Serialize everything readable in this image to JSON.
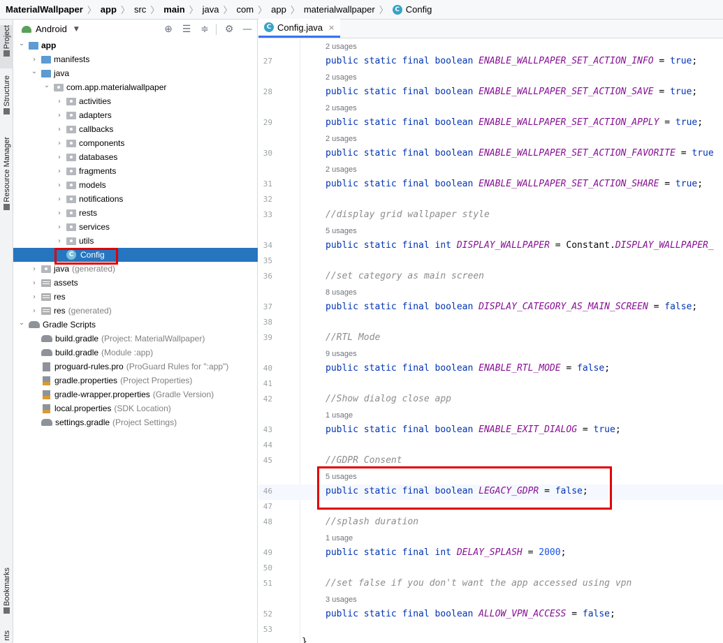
{
  "breadcrumb": {
    "items": [
      "MaterialWallpaper",
      "app",
      "src",
      "main",
      "java",
      "com",
      "app",
      "materialwallpaper"
    ],
    "bold_items": [
      "MaterialWallpaper",
      "app",
      "main"
    ],
    "current": "Config",
    "class_badge": "C"
  },
  "tool_strip": {
    "project": "Project",
    "structure": "Structure",
    "resource_manager": "Resource Manager",
    "bookmarks": "Bookmarks",
    "truncated_bottom": "nts"
  },
  "project_panel": {
    "view_label": "Android",
    "header_icons": [
      "locate-icon",
      "expand-all-icon",
      "collapse-all-icon",
      "gear-icon",
      "hide-icon"
    ],
    "tree": [
      {
        "label": "app",
        "hint": "",
        "indent": 0,
        "chev": "expanded",
        "icon": "module",
        "bold": true
      },
      {
        "label": "manifests",
        "hint": "",
        "indent": 1,
        "chev": "collapsed",
        "icon": "folder-blue"
      },
      {
        "label": "java",
        "hint": "",
        "indent": 1,
        "chev": "expanded",
        "icon": "folder-blue"
      },
      {
        "label": "com.app.materialwallpaper",
        "hint": "",
        "indent": 2,
        "chev": "expanded",
        "icon": "package"
      },
      {
        "label": "activities",
        "hint": "",
        "indent": 3,
        "chev": "collapsed",
        "icon": "package"
      },
      {
        "label": "adapters",
        "hint": "",
        "indent": 3,
        "chev": "collapsed",
        "icon": "package"
      },
      {
        "label": "callbacks",
        "hint": "",
        "indent": 3,
        "chev": "collapsed",
        "icon": "package"
      },
      {
        "label": "components",
        "hint": "",
        "indent": 3,
        "chev": "collapsed",
        "icon": "package"
      },
      {
        "label": "databases",
        "hint": "",
        "indent": 3,
        "chev": "collapsed",
        "icon": "package"
      },
      {
        "label": "fragments",
        "hint": "",
        "indent": 3,
        "chev": "collapsed",
        "icon": "package"
      },
      {
        "label": "models",
        "hint": "",
        "indent": 3,
        "chev": "collapsed",
        "icon": "package"
      },
      {
        "label": "notifications",
        "hint": "",
        "indent": 3,
        "chev": "collapsed",
        "icon": "package"
      },
      {
        "label": "rests",
        "hint": "",
        "indent": 3,
        "chev": "collapsed",
        "icon": "package"
      },
      {
        "label": "services",
        "hint": "",
        "indent": 3,
        "chev": "collapsed",
        "icon": "package"
      },
      {
        "label": "utils",
        "hint": "",
        "indent": 3,
        "chev": "collapsed",
        "icon": "package"
      },
      {
        "label": "Config",
        "hint": "",
        "indent": 3,
        "chev": "none",
        "icon": "class",
        "selected": true
      },
      {
        "label": "java",
        "hint": "(generated)",
        "indent": 1,
        "chev": "collapsed",
        "icon": "folder-gen"
      },
      {
        "label": "assets",
        "hint": "",
        "indent": 1,
        "chev": "collapsed",
        "icon": "folder-res"
      },
      {
        "label": "res",
        "hint": "",
        "indent": 1,
        "chev": "collapsed",
        "icon": "folder-res"
      },
      {
        "label": "res",
        "hint": "(generated)",
        "indent": 1,
        "chev": "collapsed",
        "icon": "folder-res"
      },
      {
        "label": "Gradle Scripts",
        "hint": "",
        "indent": 0,
        "chev": "expanded",
        "icon": "gradle"
      },
      {
        "label": "build.gradle",
        "hint": "(Project: MaterialWallpaper)",
        "indent": 1,
        "chev": "none",
        "icon": "gradle"
      },
      {
        "label": "build.gradle",
        "hint": "(Module :app)",
        "indent": 1,
        "chev": "none",
        "icon": "gradle"
      },
      {
        "label": "proguard-rules.pro",
        "hint": "(ProGuard Rules for \":app\")",
        "indent": 1,
        "chev": "none",
        "icon": "file"
      },
      {
        "label": "gradle.properties",
        "hint": "(Project Properties)",
        "indent": 1,
        "chev": "none",
        "icon": "props"
      },
      {
        "label": "gradle-wrapper.properties",
        "hint": "(Gradle Version)",
        "indent": 1,
        "chev": "none",
        "icon": "props"
      },
      {
        "label": "local.properties",
        "hint": "(SDK Location)",
        "indent": 1,
        "chev": "none",
        "icon": "props"
      },
      {
        "label": "settings.gradle",
        "hint": "(Project Settings)",
        "indent": 1,
        "chev": "none",
        "icon": "gradle"
      }
    ]
  },
  "editor": {
    "tab": {
      "label": "Config.java",
      "badge": "C",
      "close": "×"
    },
    "closing_brace": "}",
    "rows": [
      {
        "type": "usage",
        "text": "2 usages"
      },
      {
        "type": "code",
        "line": 27,
        "tokens": [
          [
            "kw",
            "public static final boolean "
          ],
          [
            "const",
            "ENABLE_WALLPAPER_SET_ACTION_INFO"
          ],
          [
            "plain",
            " = "
          ],
          [
            "kw",
            "true"
          ],
          [
            "plain",
            ";"
          ]
        ]
      },
      {
        "type": "usage",
        "text": "2 usages"
      },
      {
        "type": "code",
        "line": 28,
        "tokens": [
          [
            "kw",
            "public static final boolean "
          ],
          [
            "const",
            "ENABLE_WALLPAPER_SET_ACTION_SAVE"
          ],
          [
            "plain",
            " = "
          ],
          [
            "kw",
            "true"
          ],
          [
            "plain",
            ";"
          ]
        ]
      },
      {
        "type": "usage",
        "text": "2 usages"
      },
      {
        "type": "code",
        "line": 29,
        "tokens": [
          [
            "kw",
            "public static final boolean "
          ],
          [
            "const",
            "ENABLE_WALLPAPER_SET_ACTION_APPLY"
          ],
          [
            "plain",
            " = "
          ],
          [
            "kw",
            "true"
          ],
          [
            "plain",
            ";"
          ]
        ]
      },
      {
        "type": "usage",
        "text": "2 usages"
      },
      {
        "type": "code",
        "line": 30,
        "tokens": [
          [
            "kw",
            "public static final boolean "
          ],
          [
            "const",
            "ENABLE_WALLPAPER_SET_ACTION_FAVORITE"
          ],
          [
            "plain",
            " = "
          ],
          [
            "kw",
            "true"
          ]
        ]
      },
      {
        "type": "usage",
        "text": "2 usages"
      },
      {
        "type": "code",
        "line": 31,
        "tokens": [
          [
            "kw",
            "public static final boolean "
          ],
          [
            "const",
            "ENABLE_WALLPAPER_SET_ACTION_SHARE"
          ],
          [
            "plain",
            " = "
          ],
          [
            "kw",
            "true"
          ],
          [
            "plain",
            ";"
          ]
        ]
      },
      {
        "type": "code",
        "line": 32,
        "tokens": []
      },
      {
        "type": "code",
        "line": 33,
        "tokens": [
          [
            "comment",
            "//display grid wallpaper style"
          ]
        ]
      },
      {
        "type": "usage",
        "text": "5 usages"
      },
      {
        "type": "code",
        "line": 34,
        "tokens": [
          [
            "kw",
            "public static final int "
          ],
          [
            "const",
            "DISPLAY_WALLPAPER"
          ],
          [
            "plain",
            " = Constant."
          ],
          [
            "const",
            "DISPLAY_WALLPAPER_"
          ]
        ]
      },
      {
        "type": "code",
        "line": 35,
        "tokens": []
      },
      {
        "type": "code",
        "line": 36,
        "tokens": [
          [
            "comment",
            "//set category as main screen"
          ]
        ]
      },
      {
        "type": "usage",
        "text": "8 usages"
      },
      {
        "type": "code",
        "line": 37,
        "tokens": [
          [
            "kw",
            "public static final boolean "
          ],
          [
            "const",
            "DISPLAY_CATEGORY_AS_MAIN_SCREEN"
          ],
          [
            "plain",
            " = "
          ],
          [
            "kw",
            "false"
          ],
          [
            "plain",
            ";"
          ]
        ]
      },
      {
        "type": "code",
        "line": 38,
        "tokens": []
      },
      {
        "type": "code",
        "line": 39,
        "tokens": [
          [
            "comment",
            "//RTL Mode"
          ]
        ]
      },
      {
        "type": "usage",
        "text": "9 usages"
      },
      {
        "type": "code",
        "line": 40,
        "tokens": [
          [
            "kw",
            "public static final boolean "
          ],
          [
            "const",
            "ENABLE_RTL_MODE"
          ],
          [
            "plain",
            " = "
          ],
          [
            "kw",
            "false"
          ],
          [
            "plain",
            ";"
          ]
        ]
      },
      {
        "type": "code",
        "line": 41,
        "tokens": []
      },
      {
        "type": "code",
        "line": 42,
        "tokens": [
          [
            "comment",
            "//Show dialog close app"
          ]
        ]
      },
      {
        "type": "usage",
        "text": "1 usage"
      },
      {
        "type": "code",
        "line": 43,
        "tokens": [
          [
            "kw",
            "public static final boolean "
          ],
          [
            "const",
            "ENABLE_EXIT_DIALOG"
          ],
          [
            "plain",
            " = "
          ],
          [
            "kw",
            "true"
          ],
          [
            "plain",
            ";"
          ]
        ]
      },
      {
        "type": "code",
        "line": 44,
        "tokens": []
      },
      {
        "type": "code",
        "line": 45,
        "tokens": [
          [
            "comment",
            "//GDPR Consent"
          ]
        ]
      },
      {
        "type": "usage",
        "text": "5 usages"
      },
      {
        "type": "code",
        "line": 46,
        "current": true,
        "tokens": [
          [
            "kw",
            "public static final boolean "
          ],
          [
            "const",
            "LEGACY_GDPR"
          ],
          [
            "plain",
            " = "
          ],
          [
            "kw",
            "false"
          ],
          [
            "plain",
            ";"
          ]
        ]
      },
      {
        "type": "code",
        "line": 47,
        "tokens": []
      },
      {
        "type": "code",
        "line": 48,
        "tokens": [
          [
            "comment",
            "//splash duration"
          ]
        ]
      },
      {
        "type": "usage",
        "text": "1 usage"
      },
      {
        "type": "code",
        "line": 49,
        "tokens": [
          [
            "kw",
            "public static final int "
          ],
          [
            "const",
            "DELAY_SPLASH"
          ],
          [
            "plain",
            " = "
          ],
          [
            "num",
            "2000"
          ],
          [
            "plain",
            ";"
          ]
        ]
      },
      {
        "type": "code",
        "line": 50,
        "tokens": []
      },
      {
        "type": "code",
        "line": 51,
        "tokens": [
          [
            "comment",
            "//set false if you don't want the app accessed using vpn"
          ]
        ]
      },
      {
        "type": "usage",
        "text": "3 usages"
      },
      {
        "type": "code",
        "line": 52,
        "tokens": [
          [
            "kw",
            "public static final boolean "
          ],
          [
            "const",
            "ALLOW_VPN_ACCESS"
          ],
          [
            "plain",
            " = "
          ],
          [
            "kw",
            "false"
          ],
          [
            "plain",
            ";"
          ]
        ]
      },
      {
        "type": "code",
        "line": 53,
        "tokens": []
      }
    ]
  },
  "colors": {
    "keyword": "#0033b3",
    "constant": "#871094",
    "comment": "#8c8c8c",
    "number": "#1750eb",
    "selection": "#2675bf",
    "highlight_box": "#e00000"
  }
}
